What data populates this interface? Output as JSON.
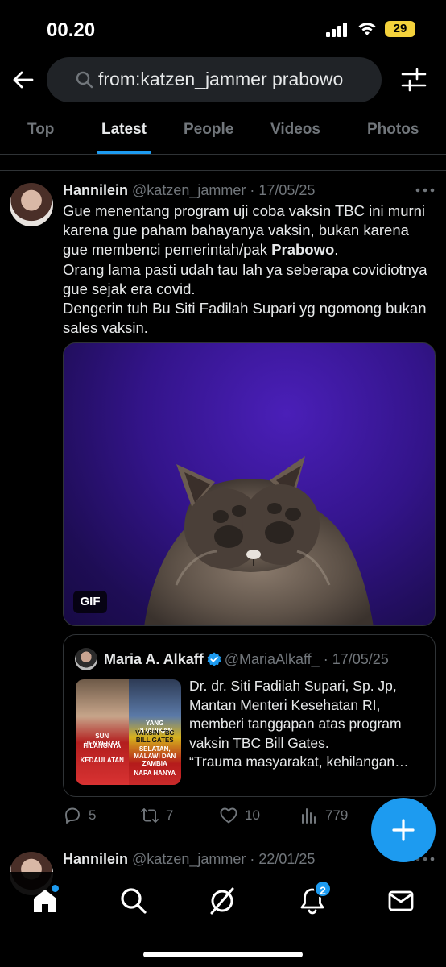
{
  "status_bar": {
    "time": "00.20",
    "battery": "29"
  },
  "search": {
    "query": "from:katzen_jammer prabowo"
  },
  "tabs": [
    {
      "label": "Top",
      "active": false
    },
    {
      "label": "Latest",
      "active": true
    },
    {
      "label": "People",
      "active": false
    },
    {
      "label": "Videos",
      "active": false
    },
    {
      "label": "Photos",
      "active": false
    }
  ],
  "tweet": {
    "name": "Hannilein",
    "handle": "@katzen_jammer",
    "date": "· 17/05/25",
    "text": {
      "line1_pre": "Gue menentang program uji coba vaksin TBC ini murni karena gue paham bahayanya vaksin, bukan karena gue membenci pemerintah/pak ",
      "line1_bold": "Prabowo",
      "line1_post": ".",
      "line2": "Orang lama pasti udah tau lah ya seberapa covidiotnya gue sejak era covid.",
      "line3": "Dengerin tuh Bu Siti Fadilah Supari yg ngomong bukan sales vaksin."
    },
    "media_badge": "GIF",
    "quote": {
      "name": "Maria A. Alkaff",
      "handle": "@MariaAlkaff_",
      "date": "· 17/05/25",
      "lines": [
        "Dr. dr. Siti Fadilah Supari, Sp. Jp,",
        "Mantan Menteri Kesehatan RI,",
        "memberi tanggapan atas program",
        "vaksin TBC Bill Gates.",
        "“Trauma masyarakat, kehilangan…"
      ],
      "image_labels": {
        "left_top": "SUN PENYEBAB",
        "left_mid": "HILANGNYA",
        "left_bot": "KEDAULATAN",
        "right_top": "YANG DIJADIKAN",
        "right_mid": "VAKSIN TBC BILL GATES",
        "right_mid2": "SELATAN, MALAWI DAN ZAMBIA",
        "right_bot": "NAPA HANYA"
      }
    },
    "stats": {
      "replies": "5",
      "reposts": "7",
      "likes": "10",
      "views": "779"
    }
  },
  "next_tweet": {
    "name": "Hannilein",
    "handle": "@katzen_jammer",
    "date": "· 22/01/25"
  },
  "nav": {
    "notification_count": "2"
  },
  "colors": {
    "accent": "#1d9bf0",
    "background": "#000000",
    "muted": "#71767b"
  }
}
